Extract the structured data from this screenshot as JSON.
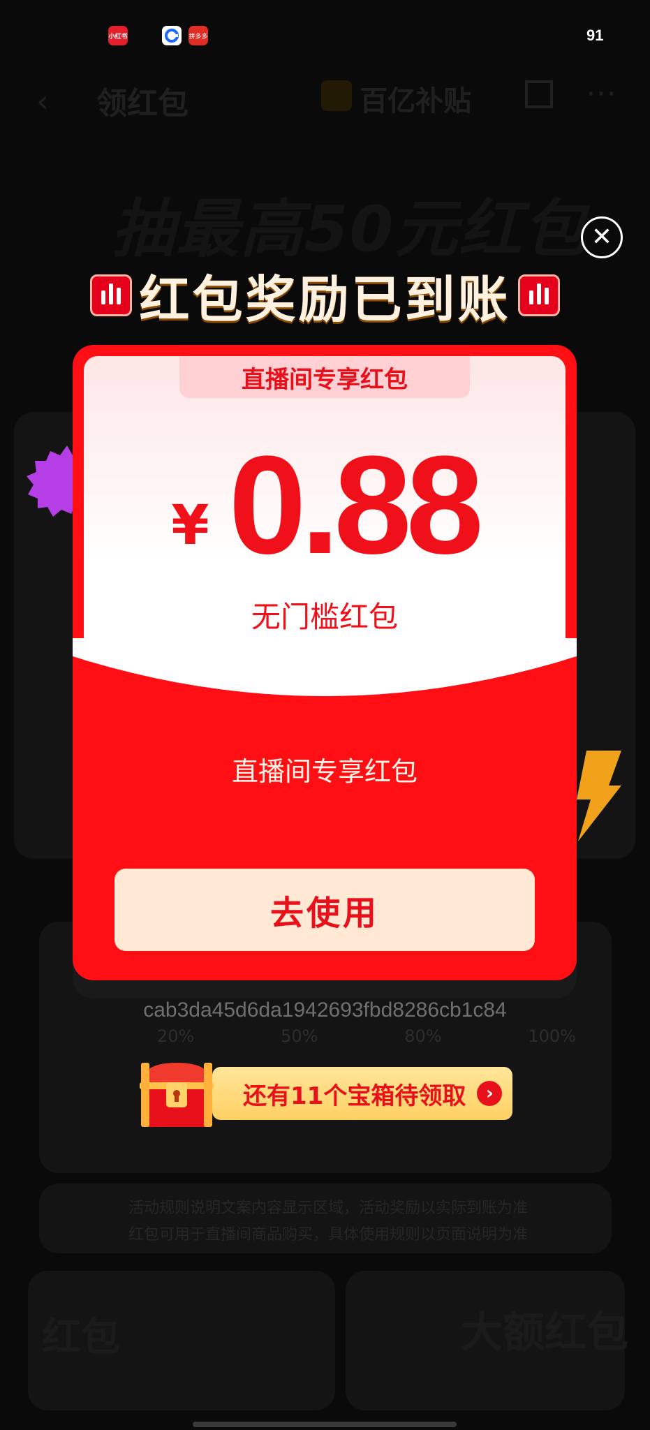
{
  "status_bar": {
    "time": "91",
    "app_icons": [
      {
        "name": "xiaohongshu-icon",
        "color": "#e51f2b",
        "label": "小红书"
      },
      {
        "name": "blue-app-icon",
        "color": "#ffffff"
      },
      {
        "name": "pinduoduo-icon",
        "color": "#e02e24",
        "label": "拼多多"
      }
    ]
  },
  "background": {
    "nav": {
      "title": "领红包",
      "center": "百亿补贴"
    },
    "headline": "抽最高50元红包",
    "progress_ticks": [
      "20%",
      "50%",
      "80%",
      "100%"
    ],
    "notice_lines": [
      "活动规则说明文案内容显示区域，活动奖励以实际到账为准",
      "红包可用于直播间商品购买，具体使用规则以页面说明为准"
    ],
    "bottom_left": "红包",
    "bottom_right": "大额红包"
  },
  "modal": {
    "title": "红包奖励已到账",
    "close_icon": "close-icon",
    "packet": {
      "tab_label": "直播间专享红包",
      "currency": "¥",
      "amount": "0.88",
      "type_label": "无门槛红包",
      "subtitle": "直播间专享红包",
      "button_label": "去使用"
    },
    "hash": "cab3da45d6da1942693fbd8286cb1c84",
    "chest_banner": {
      "text": "还有11个宝箱待领取",
      "arrow": "›"
    }
  },
  "colors": {
    "packet_red": "#ff0f14",
    "accent_red": "#e8101a",
    "button_bg": "#ffe9d4",
    "banner_gold": "#ffd063",
    "overlay": "#0a0a0a"
  }
}
